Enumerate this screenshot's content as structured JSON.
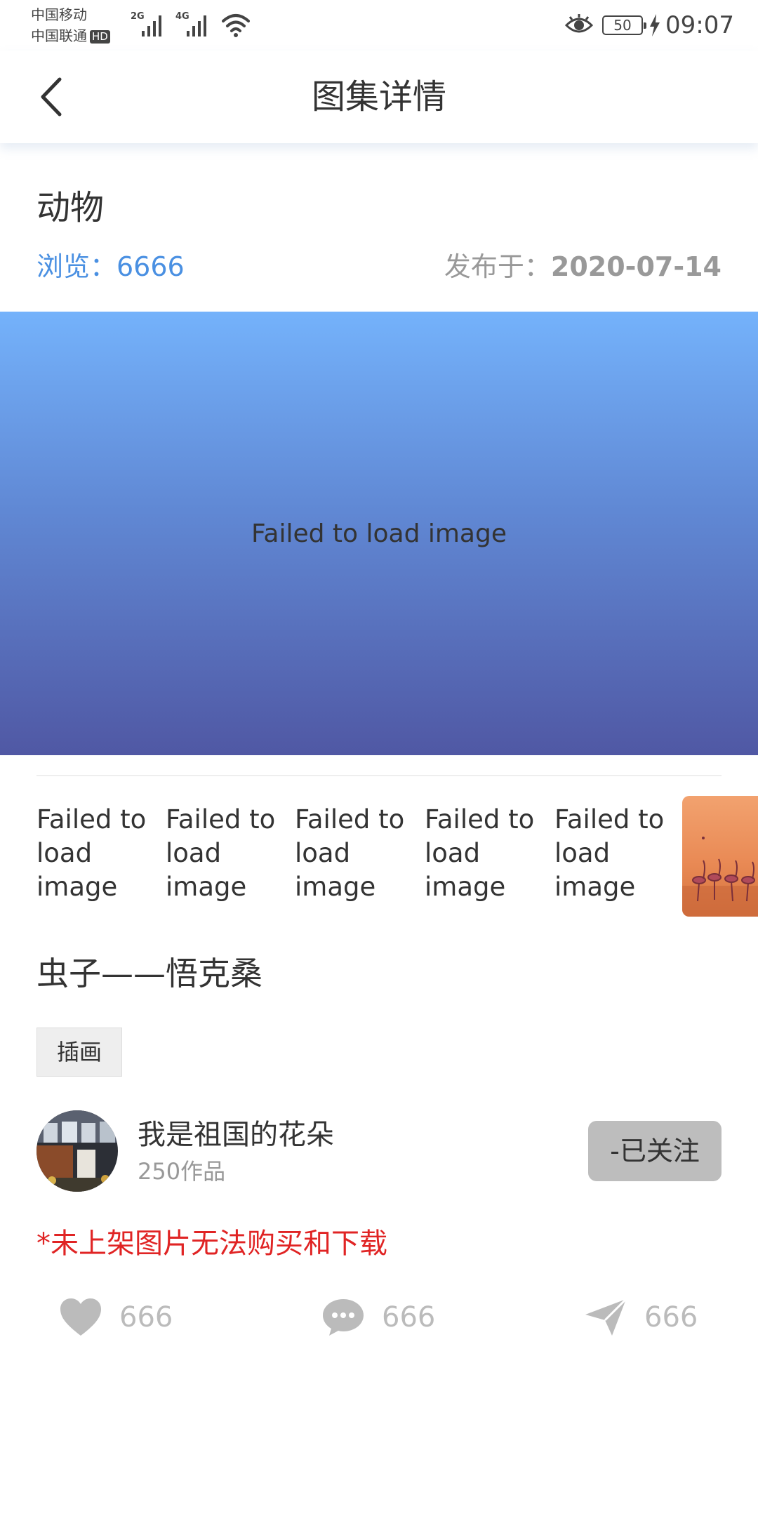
{
  "status_bar": {
    "carrier_1": "中国移动",
    "carrier_2": "中国联通",
    "hd_badge": "HD",
    "signal_1_label": "2G",
    "signal_2_label": "4G",
    "battery": "50",
    "time": "09:07"
  },
  "nav": {
    "title": "图集详情"
  },
  "album": {
    "name": "动物",
    "views": "浏览：6666",
    "published_label": "发布于：",
    "published_date": "2020-07-14"
  },
  "main_image": {
    "text": "Failed to load image"
  },
  "thumbnails": [
    "Failed to load image",
    "Failed to load image",
    "Failed to load image",
    "Failed to load image",
    "Failed to load image"
  ],
  "work": {
    "title": "虫子——悟克桑",
    "tag": "插画"
  },
  "author": {
    "name": "我是祖国的花朵",
    "works": "250作品",
    "follow_label": "-已关注"
  },
  "notice": "*未上架图片无法购买和下载",
  "actions": {
    "likes": "666",
    "comments": "666",
    "shares": "666"
  },
  "colors": {
    "accent": "#4a90e2",
    "notice": "#e02424",
    "follow_bg": "#bdbdbd"
  }
}
